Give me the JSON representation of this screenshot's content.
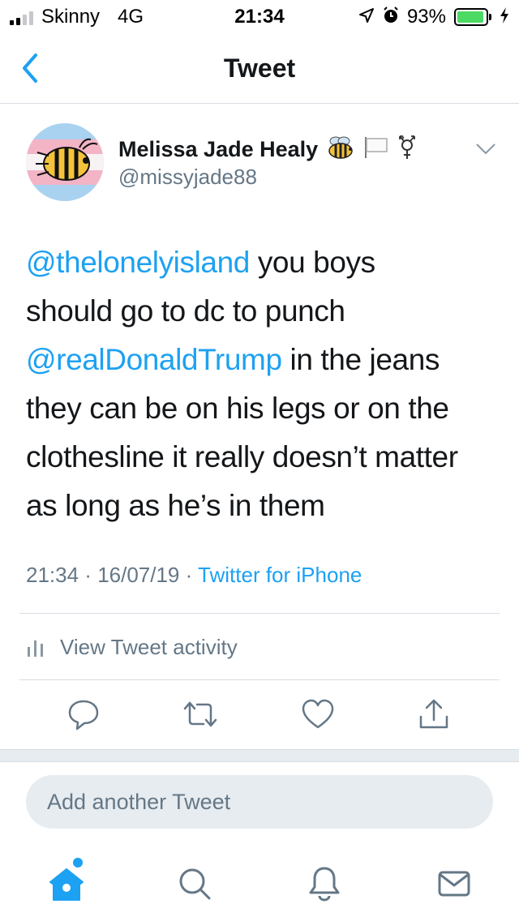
{
  "status_bar": {
    "carrier": "Skinny",
    "network": "4G",
    "time": "21:34",
    "battery_percent": "93%",
    "battery_level": 0.93,
    "icons": [
      "signal-icon",
      "location-arrow-icon",
      "alarm-icon",
      "battery-icon",
      "charging-bolt-icon"
    ]
  },
  "nav": {
    "title": "Tweet",
    "back_icon": "chevron-left-icon"
  },
  "tweet": {
    "author": {
      "display_name": "Melissa Jade Healy",
      "handle": "@missyjade88",
      "name_emojis": [
        "bee-emoji",
        "white-flag-emoji",
        "transgender-symbol-emoji"
      ]
    },
    "text_lines": [
      {
        "mention": "@thelonelyisland",
        "text": " you boys"
      },
      {
        "mention": "",
        "text": "should go to dc to punch"
      },
      {
        "mention": "@realDonaldTrump",
        "text": " in the jeans"
      },
      {
        "mention": "",
        "text": "they can be on his legs or on the"
      },
      {
        "mention": "",
        "text": "clothesline it really doesn’t matter"
      },
      {
        "mention": "",
        "text": "as long as he’s in them"
      }
    ],
    "meta": {
      "time": "21:34",
      "separator": " · ",
      "date": "16/07/19",
      "source": "Twitter for iPhone"
    },
    "activity_label": "View Tweet activity",
    "actions": [
      "reply-icon",
      "retweet-icon",
      "like-icon",
      "share-icon"
    ]
  },
  "reply": {
    "placeholder": "Add another Tweet"
  },
  "tab_bar": {
    "tabs": [
      "home-icon",
      "search-icon",
      "notifications-icon",
      "messages-icon"
    ],
    "active": "home-icon"
  },
  "colors": {
    "accent": "#1da1f2",
    "text": "#14171a",
    "secondary": "#657786",
    "divider": "#d8dde2",
    "band": "#e6ecf0",
    "battery": "#4cd964"
  }
}
